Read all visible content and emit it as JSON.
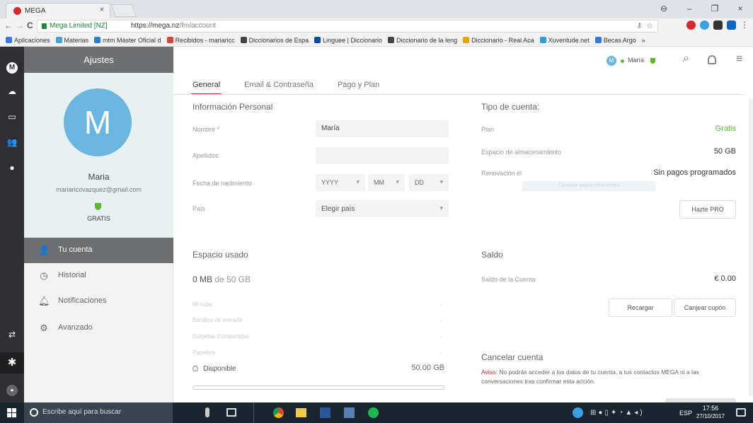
{
  "browser": {
    "tab_title": "MEGA",
    "tab_close": "×",
    "window_controls": {
      "profile": "⊖",
      "minimize": "–",
      "maximize": "❐",
      "close": "×"
    },
    "nav": {
      "back": "←",
      "forward": "→",
      "reload": "C"
    },
    "ssl_label": "Mega Limited [NZ]",
    "url_host": "https://mega.nz",
    "url_path": "/fm/account",
    "bookmarks": [
      "Aplicaciones",
      "Materias",
      "mtm Máster Oficial d",
      "Recibidos - mariaricc",
      "Diccionarios de Espa",
      "Linguee | Diccionario",
      "Diccionario de la leng",
      "Diccionario - Real Aca",
      "Xuventude.net",
      "Becas Argo",
      "»"
    ],
    "bookmark_colors": [
      "#3b78e7",
      "#4aa3d8",
      "#2b7bd4",
      "#d44638",
      "#444",
      "#0a4ea2",
      "#444",
      "#e8a600",
      "#2e9fd8",
      "#2a7ae2"
    ]
  },
  "mega": {
    "header": {
      "user": "María",
      "menu_icon": "≡",
      "search_icon": "⌕",
      "bell_icon": "bell"
    },
    "sidebar": {
      "title": "Ajustes",
      "avatar_letter": "M",
      "avatar_color": "#69b6e0",
      "name": "Maria",
      "email": "mariaricovazquez@gmail.com",
      "plan": "GRATIS",
      "items": [
        {
          "label": "Tu cuenta",
          "icon": "user-icon"
        },
        {
          "label": "Historial",
          "icon": "clock-icon"
        },
        {
          "label": "Notificaciones",
          "icon": "bell-icon"
        },
        {
          "label": "Avanzado",
          "icon": "advanced-icon"
        }
      ]
    },
    "tabs": [
      "General",
      "Email & Contraseña",
      "Pago y Plan"
    ],
    "personal": {
      "title": "Información Personal",
      "name_label": "Nombre *",
      "name_value": "María",
      "surname_label": "Apellidos",
      "surname_value": "",
      "dob_label": "Fecha de nacimiento",
      "year": "YYYY",
      "month": "MM",
      "day": "DD",
      "country_label": "País",
      "country_value": "Elegir país"
    },
    "account": {
      "title": "Tipo de cuenta:",
      "plan_label": "Plan",
      "plan_value": "Gratis",
      "storage_label": "Espacio de almacenamiento",
      "storage_value": "50 GB",
      "renewal_label": "Renovación el",
      "renewal_value": "Sin pagos programados",
      "cancel_sub": "Cancelar pagos recurrentes",
      "pro_button": "Hazte PRO"
    },
    "space": {
      "title": "Espacio usado",
      "used": "0 MB",
      "of": "de",
      "total": "50 GB",
      "folders": [
        "Mi nube",
        "Bandeja de entrada",
        "Carpetas Compartidas",
        "Papelera"
      ],
      "folder_values": [
        "-",
        "-",
        "-",
        "-"
      ],
      "available_label": "Disponible",
      "available_value": "50.00 GB",
      "used_fraction": 0
    },
    "balance": {
      "title": "Saldo",
      "label": "Saldo de la Cuenta",
      "value": "€ 0.00",
      "recharge": "Recargar",
      "redeem": "Canjear cupón"
    },
    "cancel": {
      "title": "Cancelar cuenta",
      "warn_prefix": "Aviso:",
      "warn_text": "No podrás acceder a los datos de tu cuenta, a tus contactos MEGA ni a las conversaciones tras confirmar esta acción."
    }
  },
  "taskbar": {
    "search_placeholder": "Escribe aquí para buscar",
    "lang": "ESP",
    "time": "17:56",
    "date": "27/10/2017"
  },
  "colors": {
    "accent": "#d9272e",
    "green": "#5bb82f",
    "rail": "#2f2f33",
    "sidehead": "#6d6f70"
  }
}
